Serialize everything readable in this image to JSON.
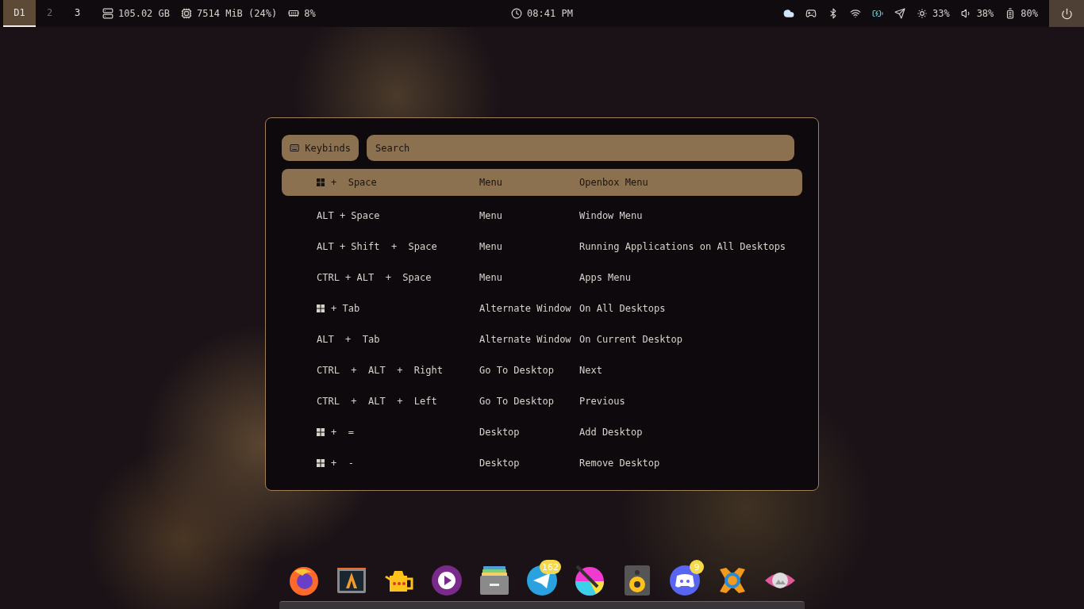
{
  "workspaces": [
    {
      "label": "D1",
      "selected": true,
      "occupied": true
    },
    {
      "label": "2",
      "selected": false,
      "occupied": false
    },
    {
      "label": "3",
      "selected": false,
      "occupied": true
    }
  ],
  "stats": [
    {
      "kind": "disk",
      "text": "105.02 GB"
    },
    {
      "kind": "memory",
      "text": "7514 MiB (24%)"
    },
    {
      "kind": "cpu",
      "text": "8%"
    }
  ],
  "clock": "08:41 PM",
  "tray": [
    {
      "kind": "cloud"
    },
    {
      "kind": "gamepad"
    },
    {
      "kind": "bluetooth"
    },
    {
      "kind": "wifi"
    },
    {
      "kind": "charging"
    },
    {
      "kind": "plane"
    }
  ],
  "indicators": [
    {
      "kind": "brightness",
      "text": "33%"
    },
    {
      "kind": "volume",
      "text": "38%"
    },
    {
      "kind": "battery",
      "text": "80%"
    }
  ],
  "keybinds_dialog": {
    "mode_button": "Keybinds",
    "search": {
      "placeholder": "Search"
    },
    "rows": [
      {
        "super": true,
        "keys": "+  Space",
        "action": "Menu",
        "description": "Openbox Menu",
        "selected": true
      },
      {
        "super": false,
        "keys": "ALT + Space",
        "action": "Menu",
        "description": "Window Menu",
        "selected": false
      },
      {
        "super": false,
        "keys": "ALT + Shift  +  Space",
        "action": "Menu",
        "description": "Running Applications on All Desktops",
        "selected": false
      },
      {
        "super": false,
        "keys": "CTRL + ALT  +  Space",
        "action": "Menu",
        "description": "Apps Menu",
        "selected": false
      },
      {
        "super": true,
        "keys": "+ Tab",
        "action": "Alternate Window",
        "description": "On All Desktops",
        "selected": false
      },
      {
        "super": false,
        "keys": "ALT  +  Tab",
        "action": "Alternate Window",
        "description": "On Current Desktop",
        "selected": false
      },
      {
        "super": false,
        "keys": "CTRL  +  ALT  +  Right",
        "action": "Go To Desktop",
        "description": "Next",
        "selected": false
      },
      {
        "super": false,
        "keys": "CTRL  +  ALT  +  Left",
        "action": "Go To Desktop",
        "description": "Previous",
        "selected": false
      },
      {
        "super": true,
        "keys": "+  =",
        "action": "Desktop",
        "description": "Add Desktop",
        "selected": false
      },
      {
        "super": true,
        "keys": "+  -",
        "action": "Desktop",
        "description": "Remove Desktop",
        "selected": false
      }
    ]
  },
  "dock": [
    {
      "kind": "globe"
    },
    {
      "kind": "terminal"
    },
    {
      "kind": "teapot"
    },
    {
      "kind": "play"
    },
    {
      "kind": "drawer"
    },
    {
      "kind": "plane",
      "badge": "162"
    },
    {
      "kind": "paint"
    },
    {
      "kind": "speaker"
    },
    {
      "kind": "gamepad",
      "badge": "9"
    },
    {
      "kind": "xcross"
    },
    {
      "kind": "eye"
    }
  ]
}
